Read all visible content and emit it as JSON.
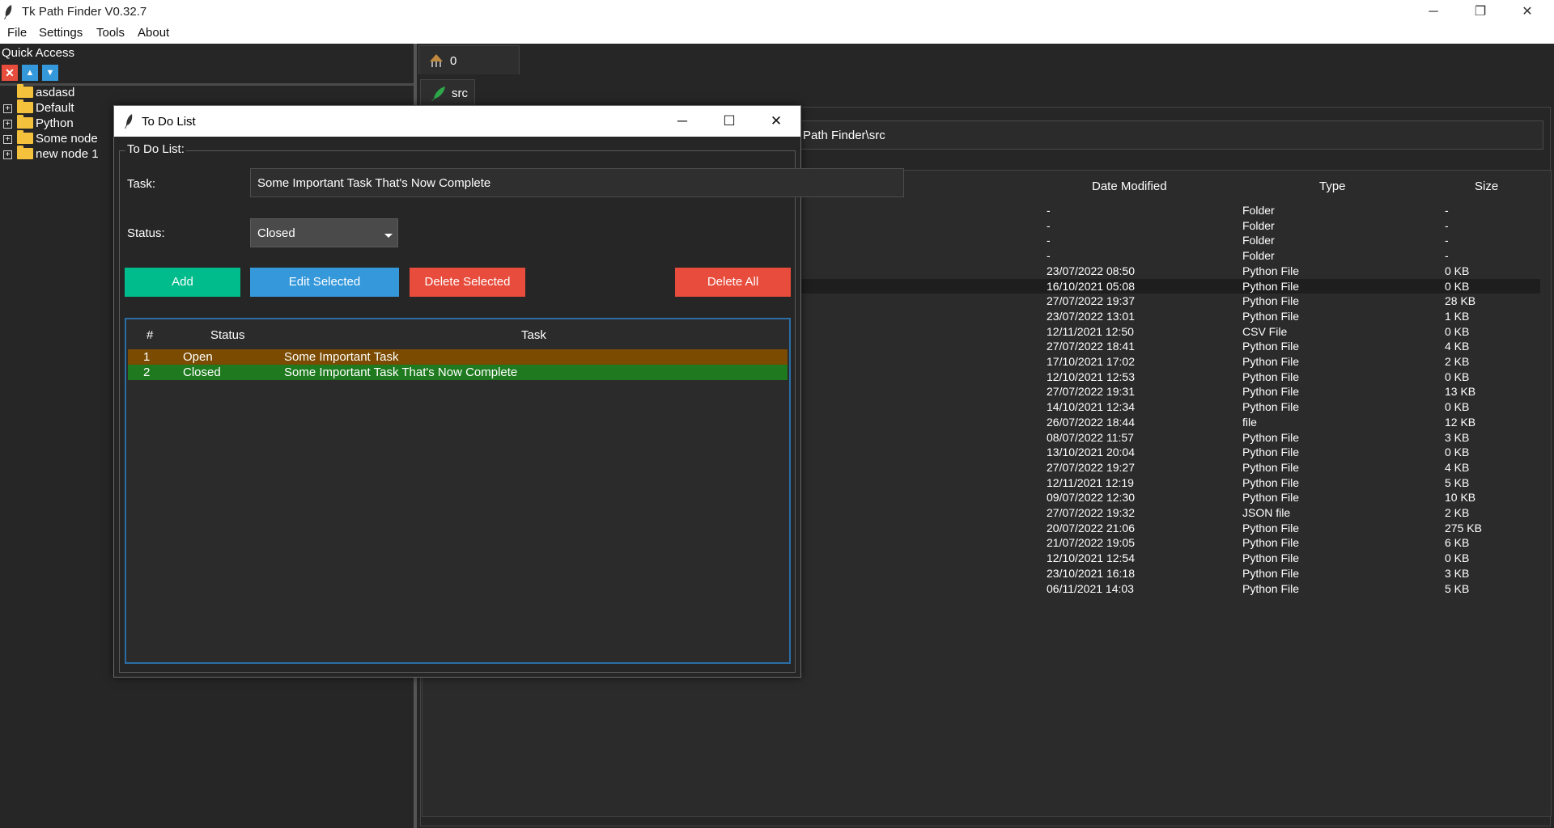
{
  "app": {
    "title": "Tk Path Finder V0.32.7",
    "icon": "feather-icon"
  },
  "window_controls": {
    "minimize": "─",
    "restore": "❐",
    "close": "✕"
  },
  "menu": [
    "File",
    "Settings",
    "Tools",
    "About"
  ],
  "quick_access": {
    "label": "Quick Access",
    "buttons": {
      "remove": "✕",
      "up": "▲",
      "down": "▼"
    },
    "items": [
      {
        "label": "asdasd",
        "expandable": false
      },
      {
        "label": "Default",
        "expandable": true
      },
      {
        "label": "Python",
        "expandable": true
      },
      {
        "label": "Some node",
        "expandable": true
      },
      {
        "label": "new node 1",
        "expandable": true
      }
    ]
  },
  "tabs": [
    {
      "label": "0"
    },
    {
      "label": "src"
    }
  ],
  "path": "Path Finder\\src",
  "file_columns": {
    "date": "Date Modified",
    "type": "Type",
    "size": "Size"
  },
  "files": [
    {
      "date": "-",
      "type": "Folder",
      "size": "-"
    },
    {
      "date": "-",
      "type": "Folder",
      "size": "-"
    },
    {
      "date": "-",
      "type": "Folder",
      "size": "-"
    },
    {
      "date": "-",
      "type": "Folder",
      "size": "-"
    },
    {
      "date": "23/07/2022  08:50",
      "type": "Python File",
      "size": "0 KB"
    },
    {
      "date": "16/10/2021  05:08",
      "type": "Python File",
      "size": "0 KB",
      "selected": true
    },
    {
      "date": "27/07/2022  19:37",
      "type": "Python File",
      "size": "28 KB"
    },
    {
      "date": "23/07/2022  13:01",
      "type": "Python File",
      "size": "1 KB"
    },
    {
      "date": "12/11/2021  12:50",
      "type": "CSV File",
      "size": "0 KB"
    },
    {
      "date": "27/07/2022  18:41",
      "type": "Python File",
      "size": "4 KB"
    },
    {
      "date": "17/10/2021  17:02",
      "type": "Python File",
      "size": "2 KB"
    },
    {
      "date": "12/10/2021  12:53",
      "type": "Python File",
      "size": "0 KB"
    },
    {
      "date": "27/07/2022  19:31",
      "type": "Python File",
      "size": "13 KB"
    },
    {
      "date": "14/10/2021  12:34",
      "type": "Python File",
      "size": "0 KB"
    },
    {
      "date": "26/07/2022  18:44",
      "type": "file",
      "size": "12 KB"
    },
    {
      "date": "08/07/2022  11:57",
      "type": "Python File",
      "size": "3 KB"
    },
    {
      "date": "13/10/2021  20:04",
      "type": "Python File",
      "size": "0 KB"
    },
    {
      "date": "27/07/2022  19:27",
      "type": "Python File",
      "size": "4 KB"
    },
    {
      "date": "12/11/2021  12:19",
      "type": "Python File",
      "size": "5 KB"
    },
    {
      "date": "09/07/2022  12:30",
      "type": "Python File",
      "size": "10 KB"
    },
    {
      "date": "27/07/2022  19:32",
      "type": "JSON file",
      "size": "2 KB"
    },
    {
      "date": "20/07/2022  21:06",
      "type": "Python File",
      "size": "275 KB"
    },
    {
      "date": "21/07/2022  19:05",
      "type": "Python File",
      "size": "6 KB"
    },
    {
      "date": "12/10/2021  12:54",
      "type": "Python File",
      "size": "0 KB"
    },
    {
      "date": "23/10/2021  16:18",
      "type": "Python File",
      "size": "3 KB"
    },
    {
      "date": "06/11/2021  14:03",
      "type": "Python File",
      "size": "5 KB"
    }
  ],
  "dialog": {
    "title": "To Do List",
    "controls": {
      "minimize": "─",
      "maximize": "☐",
      "close": "✕"
    },
    "legend": "To Do List:",
    "task_label": "Task:",
    "task_value": "Some Important Task That's Now Complete",
    "status_label": "Status:",
    "status_value": "Closed",
    "buttons": {
      "add": "Add",
      "edit": "Edit Selected",
      "delete": "Delete Selected",
      "delete_all": "Delete All"
    },
    "columns": {
      "num": "#",
      "status": "Status",
      "task": "Task"
    },
    "rows": [
      {
        "num": "1",
        "status": "Open",
        "task": "Some Important Task",
        "color": "#7a4b00"
      },
      {
        "num": "2",
        "status": "Closed",
        "task": "Some Important Task That's Now Complete",
        "color": "#1f7a1f"
      }
    ]
  },
  "colors": {
    "accent_green": "#00bc8c",
    "accent_blue": "#3498db",
    "accent_red": "#e74c3c",
    "background": "#262626"
  }
}
